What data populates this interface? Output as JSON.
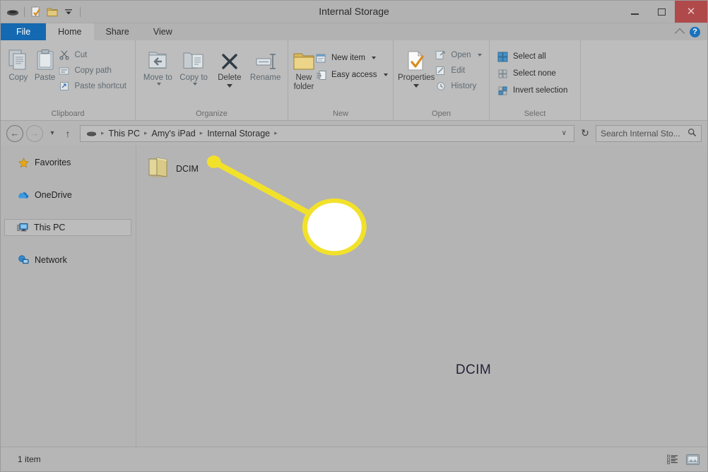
{
  "window": {
    "title": "Internal Storage",
    "controls": {
      "minimize": "minimize-button",
      "maximize": "maximize-button",
      "close_glyph": "✕"
    },
    "quick_access": [
      {
        "name": "device-icon"
      },
      {
        "name": "properties-icon"
      },
      {
        "name": "new-folder-icon"
      },
      {
        "name": "customize-qat-dropdown"
      }
    ]
  },
  "tabs": [
    {
      "label": "File",
      "active": false,
      "type": "file"
    },
    {
      "label": "Home",
      "active": true,
      "type": "normal"
    },
    {
      "label": "Share",
      "active": false,
      "type": "normal"
    },
    {
      "label": "View",
      "active": false,
      "type": "normal"
    }
  ],
  "ribbon": {
    "collapse_tooltip": "Minimize the Ribbon",
    "help_glyph": "?",
    "groups": [
      {
        "label": "Clipboard",
        "big": [
          {
            "label": "Copy",
            "icon": "copy-icon"
          },
          {
            "label": "Paste",
            "icon": "paste-icon"
          }
        ],
        "small": [
          {
            "label": "Cut",
            "icon": "scissors-icon"
          },
          {
            "label": "Copy path",
            "icon": "copy-path-icon"
          },
          {
            "label": "Paste shortcut",
            "icon": "paste-shortcut-icon"
          }
        ]
      },
      {
        "label": "Organize",
        "big": [
          {
            "label": "Move to",
            "icon": "move-to-icon",
            "caret": true
          },
          {
            "label": "Copy to",
            "icon": "copy-to-icon",
            "caret": true
          },
          {
            "label": "Delete",
            "icon": "delete-icon",
            "caret": true,
            "enabled": true
          },
          {
            "label": "Rename",
            "icon": "rename-icon"
          }
        ],
        "small": []
      },
      {
        "label": "New",
        "big": [
          {
            "label": "New folder",
            "icon": "new-folder-icon",
            "enabled": true
          }
        ],
        "small": [
          {
            "label": "New item",
            "icon": "new-item-icon",
            "caret": true,
            "enabled": true
          },
          {
            "label": "Easy access",
            "icon": "easy-access-icon",
            "caret": true,
            "enabled": true
          }
        ]
      },
      {
        "label": "Open",
        "big": [
          {
            "label": "Properties",
            "icon": "properties-icon",
            "caret": true,
            "enabled": true
          }
        ],
        "small": [
          {
            "label": "Open",
            "icon": "open-icon",
            "caret": true
          },
          {
            "label": "Edit",
            "icon": "edit-icon"
          },
          {
            "label": "History",
            "icon": "history-icon"
          }
        ]
      },
      {
        "label": "Select",
        "big": [],
        "small": [
          {
            "label": "Select all",
            "icon": "select-all-icon",
            "enabled": true
          },
          {
            "label": "Select none",
            "icon": "select-none-icon",
            "enabled": true
          },
          {
            "label": "Invert selection",
            "icon": "invert-selection-icon",
            "enabled": true
          }
        ]
      }
    ]
  },
  "address_bar": {
    "back": "←",
    "forward": "→",
    "recent_caret": "▾",
    "up": "↑",
    "breadcrumbs": [
      {
        "label": "This PC"
      },
      {
        "label": "Amy's iPad"
      },
      {
        "label": "Internal Storage"
      }
    ],
    "separator": "▸",
    "dropdown_glyph": "∨",
    "refresh_glyph": "↻",
    "search_placeholder": "Search Internal Sto...",
    "search_value": "",
    "search_icon": "search-icon"
  },
  "sidebar": {
    "items": [
      {
        "label": "Favorites",
        "icon": "star-icon",
        "selected": false
      },
      {
        "label": "OneDrive",
        "icon": "cloud-icon",
        "selected": false
      },
      {
        "label": "This PC",
        "icon": "computer-icon",
        "selected": true
      },
      {
        "label": "Network",
        "icon": "network-icon",
        "selected": false
      }
    ]
  },
  "files": [
    {
      "label": "DCIM",
      "icon": "folder-icon"
    }
  ],
  "callout": {
    "label": "DCIM",
    "ring_color": "#F2E12B",
    "fill_color": "#FFFFFF",
    "dot_color": "#F2E12B"
  },
  "status_bar": {
    "item_count": "1 item",
    "views": [
      {
        "name": "details-view-button"
      },
      {
        "name": "large-icons-view-button"
      }
    ]
  }
}
